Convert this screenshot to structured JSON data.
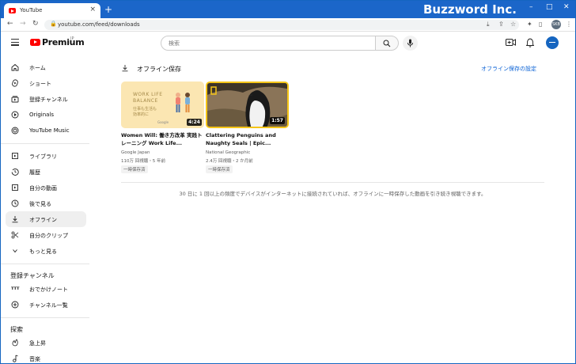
{
  "browser": {
    "tab_title": "YouTube",
    "tab_close": "×",
    "new_tab": "+",
    "url": "youtube.com/feed/downloads",
    "brand_overlay": "Buzzword Inc.",
    "window_controls": [
      "–",
      "□",
      "✕"
    ],
    "profile_initials": "SKB"
  },
  "header": {
    "wordmark": "Premium",
    "wordmark_sup": "JP",
    "search_placeholder": "検索"
  },
  "sidebar": {
    "items": [
      {
        "label": "ホーム",
        "icon": "home-icon"
      },
      {
        "label": "ショート",
        "icon": "shorts-icon"
      },
      {
        "label": "登録チャンネル",
        "icon": "subscriptions-icon"
      },
      {
        "label": "Originals",
        "icon": "originals-icon"
      },
      {
        "label": "YouTube Music",
        "icon": "music-icon"
      },
      {
        "label": "ライブラリ",
        "icon": "library-icon"
      },
      {
        "label": "履歴",
        "icon": "history-icon"
      },
      {
        "label": "自分の動画",
        "icon": "my-videos-icon"
      },
      {
        "label": "後で見る",
        "icon": "watch-later-icon"
      },
      {
        "label": "オフライン",
        "icon": "download-icon"
      },
      {
        "label": "自分のクリップ",
        "icon": "clip-icon"
      },
      {
        "label": "もっと見る",
        "icon": "chevron-down-icon"
      }
    ],
    "subs_heading": "登録チャンネル",
    "subs": [
      {
        "label": "おでかけノート",
        "icon": "channel-avatar-icon"
      },
      {
        "label": "チャンネル一覧",
        "icon": "add-circle-icon"
      }
    ],
    "explore_heading": "探索",
    "explore": [
      {
        "label": "急上昇",
        "icon": "trending-icon"
      },
      {
        "label": "音楽",
        "icon": "music-note-icon"
      }
    ]
  },
  "main": {
    "title": "オフライン保存",
    "settings_link": "オフライン保存の設定",
    "videos": [
      {
        "title": "Women Will: 働き方改革 実践トレーニング Work Life...",
        "channel": "Google Japan",
        "meta": "110万 回視聴・5 年前",
        "badge": "一時保存済",
        "duration": "4:24",
        "thumb_text": [
          "WORK LIFE",
          "BALANCE",
          "仕事も生活も",
          "効率的に",
          "Google"
        ]
      },
      {
        "title": "Clattering Penguins and Naughty Seals | Epic...",
        "channel": "National Geographic",
        "meta": "2.4万 回視聴・2 か月前",
        "badge": "一時保存済",
        "duration": "1:57"
      }
    ],
    "notice": "30 日に 1 回以上の頻度でデバイスがインターネットに接続されていれば、オフラインに一時保存した動画を引き続き視聴できます。"
  }
}
